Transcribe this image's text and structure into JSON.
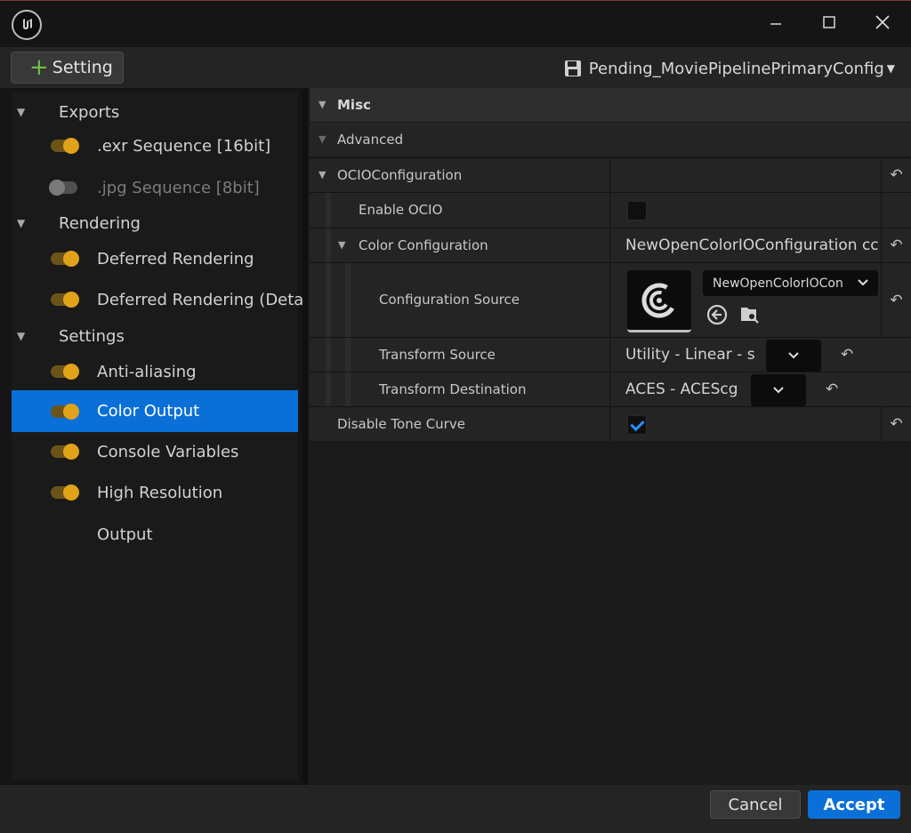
{
  "toolbar": {
    "add_setting_label": "Setting",
    "preset_name": "Pending_MoviePipelinePrimaryConfig"
  },
  "tree": {
    "exports": "Exports",
    "exr": ".exr Sequence [16bit]",
    "jpg": ".jpg Sequence [8bit]",
    "rendering": "Rendering",
    "deferred": "Deferred Rendering",
    "deferred_detail": "Deferred Rendering (Detail",
    "settings": "Settings",
    "antialiasing": "Anti-aliasing",
    "color_output": "Color Output",
    "console_vars": "Console Variables",
    "high_res": "High Resolution",
    "output": "Output"
  },
  "details": {
    "misc": "Misc",
    "advanced": "Advanced",
    "ocio_config": "OCIOConfiguration",
    "enable_ocio": "Enable OCIO",
    "color_configuration": "Color Configuration",
    "color_configuration_value": "NewOpenColorIOConfiguration cc",
    "configuration_source": "Configuration Source",
    "configuration_source_value": "NewOpenColorIOCon",
    "transform_source": "Transform Source",
    "transform_source_value": "Utility - Linear - s",
    "transform_destination": "Transform Destination",
    "transform_destination_value": "ACES - ACEScg",
    "disable_tone_curve": "Disable Tone Curve"
  },
  "states": {
    "enable_ocio_checked": false,
    "disable_tone_curve_checked": true
  },
  "buttons": {
    "cancel": "Cancel",
    "accept": "Accept"
  },
  "colors": {
    "accent": "#0a70d8",
    "toggle_on": "#e0a218",
    "add_plus": "#6fbe42"
  }
}
